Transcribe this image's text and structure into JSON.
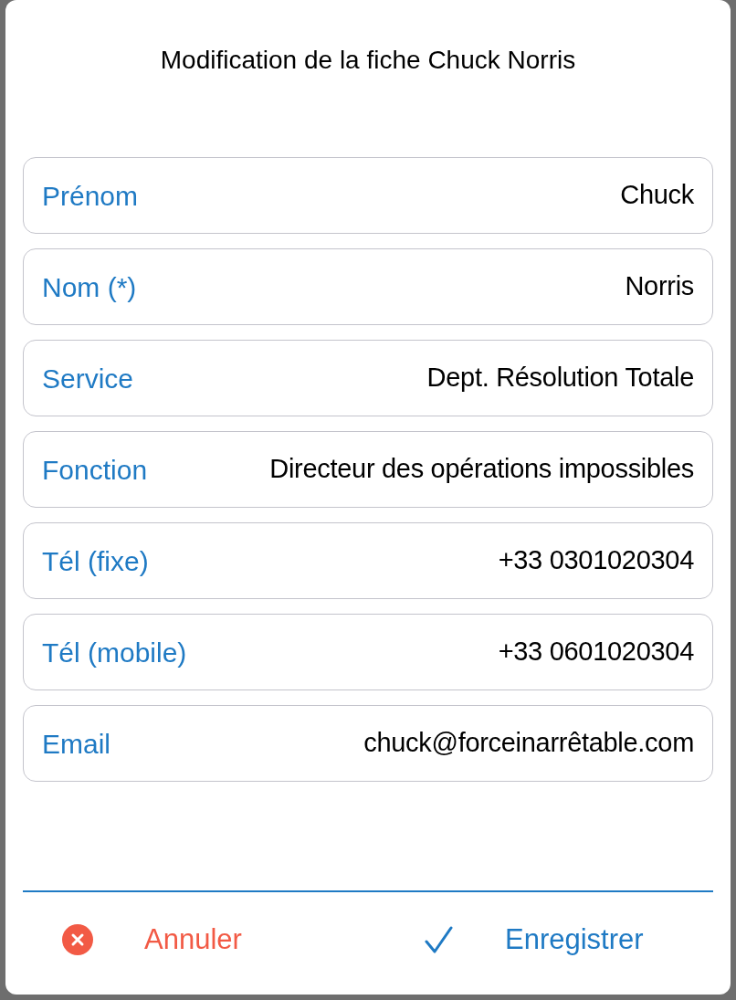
{
  "dialog": {
    "title": "Modification de la fiche Chuck Norris"
  },
  "fields": [
    {
      "label": "Prénom",
      "value": "Chuck"
    },
    {
      "label": "Nom (*)",
      "value": "Norris"
    },
    {
      "label": "Service",
      "value": "Dept. Résolution Totale"
    },
    {
      "label": "Fonction",
      "value": "Directeur des opérations impossibles"
    },
    {
      "label": "Tél (fixe)",
      "value": "+33 0301020304"
    },
    {
      "label": "Tél (mobile)",
      "value": "+33 0601020304"
    },
    {
      "label": "Email",
      "value": "chuck@forceinarrêtable.com"
    }
  ],
  "buttons": [
    {
      "kind": "cancel",
      "label": "Annuler"
    },
    {
      "kind": "save",
      "label": "Enregistrer"
    }
  ]
}
